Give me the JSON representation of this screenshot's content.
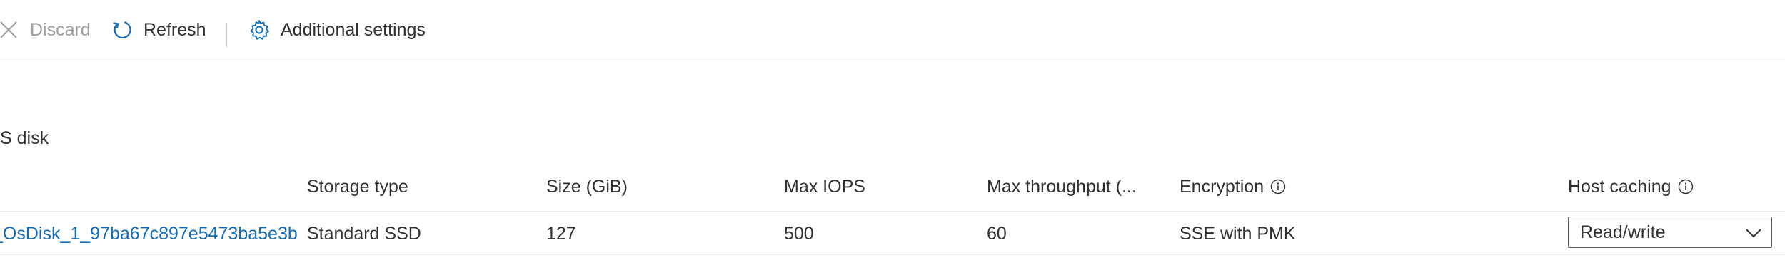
{
  "toolbar": {
    "discard_label": "Discard",
    "refresh_label": "Refresh",
    "settings_label": "Additional settings"
  },
  "section": {
    "title": "S disk"
  },
  "table": {
    "headers": {
      "name": ".",
      "storage_type": "Storage type",
      "size": "Size (GiB)",
      "max_iops": "Max IOPS",
      "max_throughput": "Max throughput (...",
      "encryption": "Encryption",
      "host_caching": "Host caching"
    },
    "rows": [
      {
        "name": "_OsDisk_1_97ba67c897e5473ba5e3b",
        "storage_type": "Standard SSD",
        "size": "127",
        "max_iops": "500",
        "max_throughput": "60",
        "encryption": "SSE with PMK",
        "host_caching": "Read/write"
      }
    ]
  },
  "colors": {
    "link": "#0f6cbd",
    "text": "#323130",
    "disabled": "#a19f9d",
    "border": "#c8c6c4"
  }
}
